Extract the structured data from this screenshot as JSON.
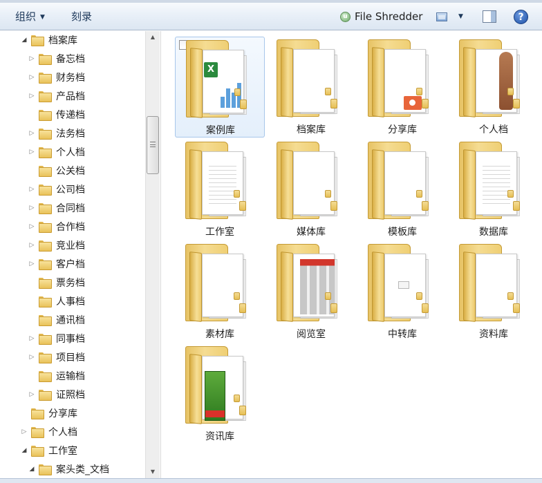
{
  "toolbar": {
    "organize_label": "组织",
    "burn_label": "刻录",
    "shredder_label": "File Shredder",
    "help_label": "?"
  },
  "nav": {
    "items": [
      {
        "label": "档案库",
        "level": 1,
        "expander": "open"
      },
      {
        "label": "备忘档",
        "level": 2,
        "expander": "closed"
      },
      {
        "label": "财务档",
        "level": 2,
        "expander": "closed"
      },
      {
        "label": "产品档",
        "level": 2,
        "expander": "closed"
      },
      {
        "label": "传递档",
        "level": 2,
        "expander": "none"
      },
      {
        "label": "法务档",
        "level": 2,
        "expander": "closed"
      },
      {
        "label": "个人档",
        "level": 2,
        "expander": "closed"
      },
      {
        "label": "公关档",
        "level": 2,
        "expander": "none"
      },
      {
        "label": "公司档",
        "level": 2,
        "expander": "closed"
      },
      {
        "label": "合同档",
        "level": 2,
        "expander": "closed"
      },
      {
        "label": "合作档",
        "level": 2,
        "expander": "closed"
      },
      {
        "label": "竞业档",
        "level": 2,
        "expander": "closed"
      },
      {
        "label": "客户档",
        "level": 2,
        "expander": "closed"
      },
      {
        "label": "票务档",
        "level": 2,
        "expander": "none"
      },
      {
        "label": "人事档",
        "level": 2,
        "expander": "none"
      },
      {
        "label": "通讯档",
        "level": 2,
        "expander": "none"
      },
      {
        "label": "同事档",
        "level": 2,
        "expander": "closed"
      },
      {
        "label": "项目档",
        "level": 2,
        "expander": "closed"
      },
      {
        "label": "运输档",
        "level": 2,
        "expander": "none"
      },
      {
        "label": "证照档",
        "level": 2,
        "expander": "closed"
      },
      {
        "label": "分享库",
        "level": 1,
        "expander": "none"
      },
      {
        "label": "个人档",
        "level": 1,
        "expander": "closed"
      },
      {
        "label": "工作室",
        "level": 1,
        "expander": "open"
      },
      {
        "label": "案头类_文档",
        "level": 2,
        "expander": "open"
      }
    ]
  },
  "content": {
    "folders": [
      {
        "label": "案例库",
        "preview": "excel",
        "selected": true
      },
      {
        "label": "档案库",
        "preview": "plain",
        "selected": false
      },
      {
        "label": "分享库",
        "preview": "ppt",
        "selected": false
      },
      {
        "label": "个人档",
        "preview": "person",
        "selected": false
      },
      {
        "label": "工作室",
        "preview": "doc",
        "selected": false
      },
      {
        "label": "媒体库",
        "preview": "plain",
        "selected": false
      },
      {
        "label": "模板库",
        "preview": "plain",
        "selected": false
      },
      {
        "label": "数据库",
        "preview": "doc",
        "selected": false
      },
      {
        "label": "素材库",
        "preview": "plain",
        "selected": false
      },
      {
        "label": "阅览室",
        "preview": "collage",
        "selected": false
      },
      {
        "label": "中转库",
        "preview": "envelope",
        "selected": false
      },
      {
        "label": "资料库",
        "preview": "plain",
        "selected": false
      },
      {
        "label": "资讯库",
        "preview": "book",
        "selected": false
      }
    ]
  },
  "colors": {
    "selection_border": "#a7c6ea",
    "folder_yellow": "#f5dc92",
    "toolbar_text": "#1e395b"
  }
}
